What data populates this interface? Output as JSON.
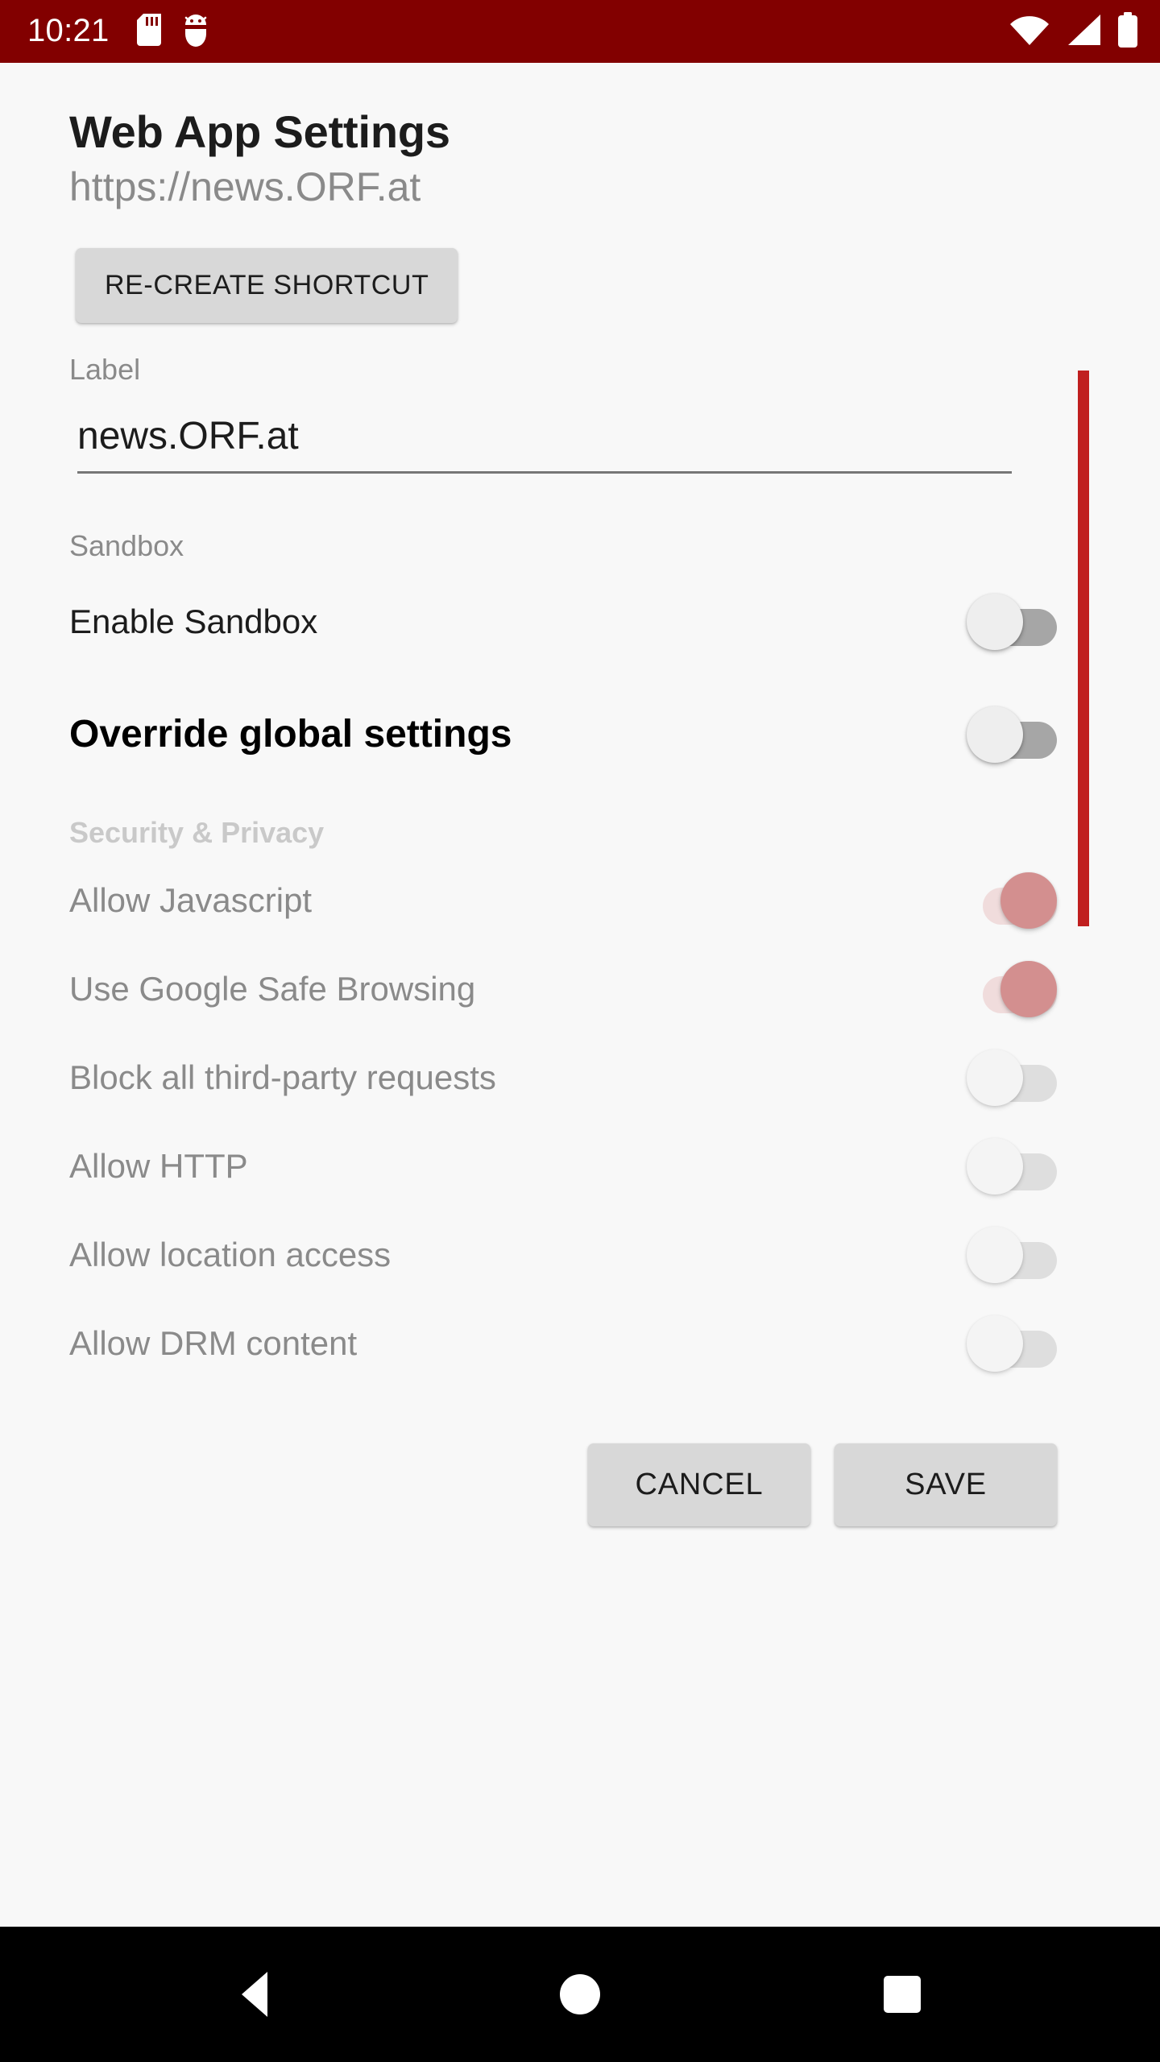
{
  "status_bar": {
    "time": "10:21",
    "background_color": "#820000",
    "left_icons": [
      "sd-card-icon",
      "android-debug-icon"
    ],
    "right_icons": [
      "wifi-icon",
      "cellular-signal-icon",
      "battery-full-icon"
    ]
  },
  "header": {
    "title": "Web App Settings",
    "subtitle": "https://news.ORF.at"
  },
  "shortcut": {
    "recreate_label": "RE-CREATE SHORTCUT"
  },
  "label_field": {
    "hint": "Label",
    "value": "news.ORF.at",
    "placeholder": "Label"
  },
  "sandbox": {
    "section_header": "Sandbox",
    "rows": [
      {
        "label": "Enable Sandbox",
        "state": "off",
        "enabled": true
      }
    ]
  },
  "override": {
    "label": "Override global settings",
    "state": "off",
    "enabled": true
  },
  "security_privacy": {
    "section_header": "Security & Privacy",
    "disabled": true,
    "rows": [
      {
        "label": "Allow Javascript",
        "state": "on",
        "enabled": false
      },
      {
        "label": "Use Google Safe Browsing",
        "state": "on",
        "enabled": false
      },
      {
        "label": "Block all third-party requests",
        "state": "off",
        "enabled": false
      },
      {
        "label": "Allow HTTP",
        "state": "off",
        "enabled": false
      },
      {
        "label": "Allow location access",
        "state": "off",
        "enabled": false
      },
      {
        "label": "Allow DRM content",
        "state": "off",
        "enabled": false
      }
    ]
  },
  "actions": {
    "cancel_label": "CANCEL",
    "save_label": "SAVE"
  },
  "scrollbar": {
    "color": "#c01f1f"
  },
  "nav_bar": {
    "back": "back-icon",
    "home": "home-icon",
    "recents": "recents-icon"
  },
  "colors": {
    "accent": "#c01f1f",
    "status_bar": "#820000",
    "background": "#f8f8f8",
    "button": "#d8d8d8"
  }
}
